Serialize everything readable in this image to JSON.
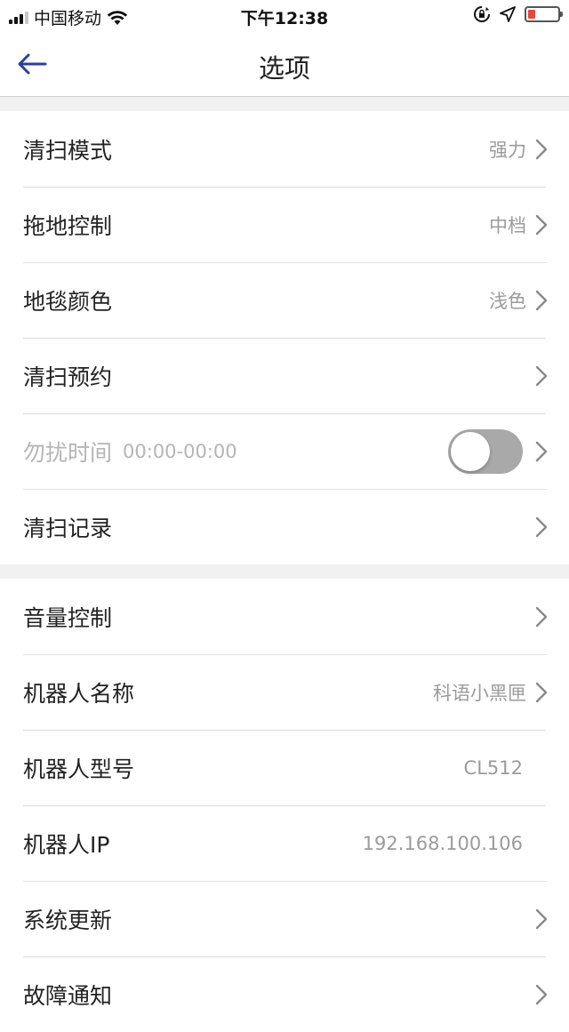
{
  "status_bar": {
    "carrier": "中国移动",
    "time": "下午12:38"
  },
  "nav": {
    "title": "选项"
  },
  "groups": [
    {
      "rows": [
        {
          "label": "清扫模式",
          "value": "强力",
          "arrow": true
        },
        {
          "label": "拖地控制",
          "value": "中档",
          "arrow": true
        },
        {
          "label": "地毯颜色",
          "value": "浅色",
          "arrow": true
        },
        {
          "label": "清扫预约",
          "value": "",
          "arrow": true
        },
        {
          "label": "勿扰时间",
          "sublabel": "00:00-00:00",
          "toggle": false,
          "disabled": true,
          "arrow": true
        },
        {
          "label": "清扫记录",
          "value": "",
          "arrow": true
        }
      ]
    },
    {
      "rows": [
        {
          "label": "音量控制",
          "value": "",
          "arrow": true
        },
        {
          "label": "机器人名称",
          "value": "科语小黑匣",
          "arrow": true
        },
        {
          "label": "机器人型号",
          "value": "CL512",
          "arrow": false
        },
        {
          "label": "机器人IP",
          "value": "192.168.100.106",
          "arrow": false
        },
        {
          "label": "系统更新",
          "value": "",
          "arrow": true
        },
        {
          "label": "故障通知",
          "value": "",
          "arrow": true
        }
      ]
    }
  ],
  "colors": {
    "accent": "#2c3e9e",
    "battery_low": "#e8453c",
    "divider": "#dcdcdc",
    "section_gap": "#f1f1f1"
  },
  "icons": {
    "back": "arrow-left-icon",
    "chevron": "chevron-right-icon",
    "wifi": "wifi-icon",
    "signal": "signal-icon",
    "lock_rotation": "orientation-lock-icon",
    "location": "location-arrow-icon",
    "battery": "battery-icon"
  }
}
